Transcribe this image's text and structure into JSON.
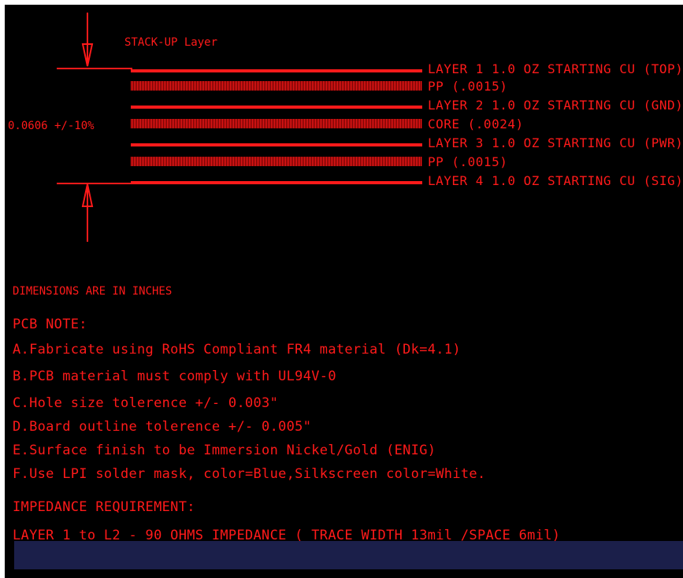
{
  "title": "STACK-UP Layer",
  "thickness_label": "0.0606 +/-10%",
  "layers": [
    "LAYER 1 1.0 OZ STARTING CU (TOP)",
    "PP (.0015)",
    "LAYER 2 1.0 OZ STARTING CU (GND)",
    "CORE (.0024)",
    "LAYER 3 1.0 OZ STARTING CU (PWR)",
    "PP (.0015)",
    "LAYER 4 1.0 OZ STARTING CU (SIG)"
  ],
  "dimensions_note": "DIMENSIONS ARE IN INCHES",
  "pcb_note": {
    "heading": "PCB NOTE:",
    "items": [
      "A.Fabricate using RoHS Compliant FR4 material (Dk=4.1)",
      "B.PCB material must comply with UL94V-0",
      "C.Hole size tolerence +/- 0.003\"",
      "D.Board outline tolerence +/- 0.005\"",
      "E.Surface finish to be Immersion Nickel/Gold (ENIG)",
      "F.Use LPI solder mask, color=Blue,Silkscreen color=White."
    ]
  },
  "impedance": {
    "heading": "IMPEDANCE REQUIREMENT:",
    "line": "LAYER 1 to L2 - 90 OHMS IMPEDANCE ( TRACE WIDTH 13mil /SPACE 6mil)"
  },
  "colors": {
    "drawing": "#ff1a1a",
    "background": "#000000",
    "bar": "#1b1f4a"
  }
}
